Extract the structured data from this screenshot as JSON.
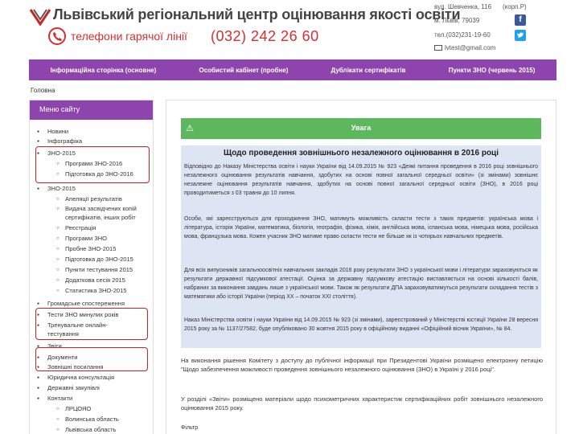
{
  "header": {
    "title": "Львівський регіональний центр оцінювання якості освіти",
    "hotline_label": "телефони гарячої лінії",
    "hotline_number": "(032) 242 26 60",
    "address_street": "вул. Шевченка, 116",
    "address_corp": "(корп.Р)",
    "address_city": "м. Львів, 79039",
    "phone": "тел.(032)231-19-60",
    "email": "lvtest@gmail.com"
  },
  "nav": {
    "items": [
      "Інформаційна сторінка (основне)",
      "Особистий кабінет (пробне)",
      "Дублікати сертифікатів",
      "Пункти ЗНО (червень 2015)"
    ]
  },
  "breadcrumb": "Головна",
  "sidebar": {
    "title": "Меню сайту",
    "items": [
      {
        "label": "Новини",
        "level": "top"
      },
      {
        "label": "Інфографіка",
        "level": "top"
      },
      {
        "label": "ЗНО-2015",
        "level": "top"
      },
      {
        "label": "Програми ЗНО-2016",
        "level": "sub"
      },
      {
        "label": "Підготовка до ЗНО-2016",
        "level": "sub"
      },
      {
        "label": "ЗНО-2015",
        "level": "top"
      },
      {
        "label": "Апеляції результатів",
        "level": "sub"
      },
      {
        "label": "Видача засвідчених копій",
        "level": "sub"
      },
      {
        "label": "сертифікатів, інших робіт",
        "level": "sub"
      },
      {
        "label": "Реєстрація",
        "level": "sub"
      },
      {
        "label": "Програми ЗНО",
        "level": "sub"
      },
      {
        "label": "Пробне ЗНО-2015",
        "level": "sub"
      },
      {
        "label": "Підготовка до ЗНО-2015",
        "level": "sub"
      },
      {
        "label": "Пункти тестування 2015",
        "level": "sub"
      },
      {
        "label": "Додаткова сесія 2015",
        "level": "sub"
      },
      {
        "label": "Статистика ЗНО-2015",
        "level": "sub"
      },
      {
        "label": "Громадське спостереження",
        "level": "top"
      },
      {
        "label": "Тести ЗНО минулих років",
        "level": "top"
      },
      {
        "label": "Тренувальне онлайн-",
        "level": "top"
      },
      {
        "label": "тестування",
        "level": "cont"
      },
      {
        "label": "Звіти",
        "level": "top"
      },
      {
        "label": "Документи",
        "level": "top"
      },
      {
        "label": "Зовнішні посилання",
        "level": "top"
      },
      {
        "label": "Юридична консультація",
        "level": "top"
      },
      {
        "label": "Державні закупівлі",
        "level": "top"
      },
      {
        "label": "Контакти",
        "level": "top"
      },
      {
        "label": "ЛРЦОЯО",
        "level": "sub"
      },
      {
        "label": "Волинська область",
        "level": "sub"
      },
      {
        "label": "Львівська область",
        "level": "sub"
      }
    ]
  },
  "main": {
    "alert_title": "Увага",
    "notice_title": "Щодо проведення зовнішнього незалежного оцінювання в 2016 році",
    "p1": "Відповідно до Наказу Міністерства освіти і науки України від 14.09.2015 № 923 «Деякі питання проведення в 2016 році зовнішнього незалежного оцінювання результатів навчання, здобутих на основі повної загальної середньої освіти» (зі змінами) зовнішнє незалежне оцінювання результатів навчання, здобутих на основі повної загальної середньої освіти (ЗНО), в 2016 році проводитиметься з 03 травня до 10 липня.",
    "p2": "Особи, які зареєструються для проходження ЗНО, матимуть можливість скласти тести з таких предметів: українська мова і література, історія України, математика, біологія, географія, фізика, хімія, англійська мова, іспанська мова, німецька мова, російська мова, французька мова. Кожен учасник ЗНО матиме право скласти тести не більше як із чотирьох навчальних предметів.",
    "p3": "Для всіх випускників загальноосвітніх навчальних закладів 2016 року результати ЗНО з української мови і літератури зараховуються як результати державної підсумкової атестації. Оцінка за державну підсумкову атестацію виставляється на основі кількості балів, набраних за виконання завдань лише з української мови. Також як результати ДПА зараховуватимуться результати складання тестів з математики або історії України (період ХХ – початок ХХІ століття).",
    "p4": "Наказ Міністерства освіти і науки України від 14.09.2015 № 923 (зі змінами), зареєстрований у Міністерстві юстиції України 28 вересня 2015 року за № 1137/27582, буде опубліковано 30 жовтня 2015 року в офіційному виданні «Офіційний вісник України», № 84.",
    "p5": "На виконання рішення Комітету з доступу до публічної інформації при Президентові України розміщено електронну петицію \"Щодо забезпечення можливості проведення зовнішнього незалежного оцінювання (ЗНО) в Україні у 2016 році\".",
    "p6": "У розділі «Звіти» розміщено матеріали щодо психометричних характеристик сертифікаційних робіт зовнішнього незалежного оцінювання 2015 року.",
    "filter_label": "Фільтр"
  },
  "colors": {
    "nav_bg": "#8e44ad",
    "alert_bg": "#5cb85c",
    "notice_bg": "#dde5f4",
    "accent_red": "#d32f2f"
  }
}
